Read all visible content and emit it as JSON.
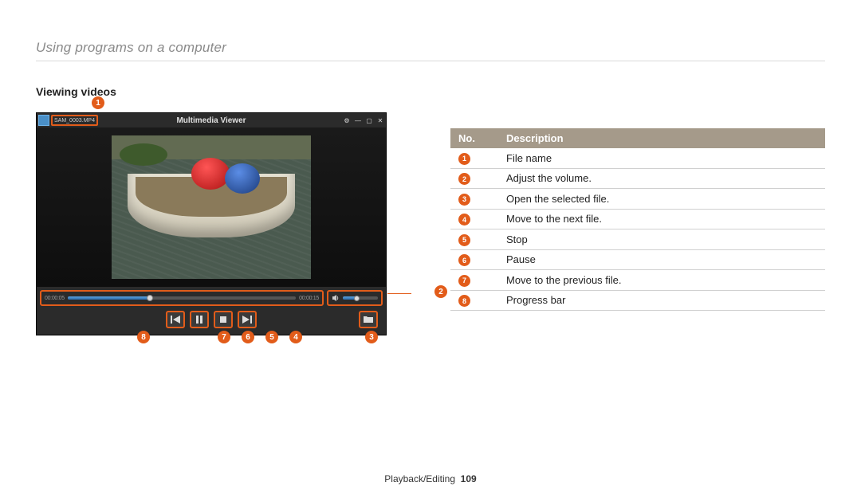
{
  "chapter_title": "Using programs on a computer",
  "section_title": "Viewing videos",
  "player": {
    "window_title": "Multimedia Viewer",
    "filename": "SAM_0003.MP4",
    "time_current": "00:00:05",
    "time_total": "00:00:15"
  },
  "callouts": {
    "c1": "1",
    "c2": "2",
    "c3": "3",
    "c4": "4",
    "c5": "5",
    "c6": "6",
    "c7": "7",
    "c8": "8"
  },
  "table": {
    "header_no": "No.",
    "header_desc": "Description",
    "rows": [
      {
        "num": "1",
        "desc": "File name"
      },
      {
        "num": "2",
        "desc": "Adjust the volume."
      },
      {
        "num": "3",
        "desc": "Open the selected file."
      },
      {
        "num": "4",
        "desc": "Move to the next file."
      },
      {
        "num": "5",
        "desc": "Stop"
      },
      {
        "num": "6",
        "desc": "Pause"
      },
      {
        "num": "7",
        "desc": "Move to the previous file."
      },
      {
        "num": "8",
        "desc": "Progress bar"
      }
    ]
  },
  "footer": {
    "section": "Playback/Editing",
    "page": "109"
  }
}
